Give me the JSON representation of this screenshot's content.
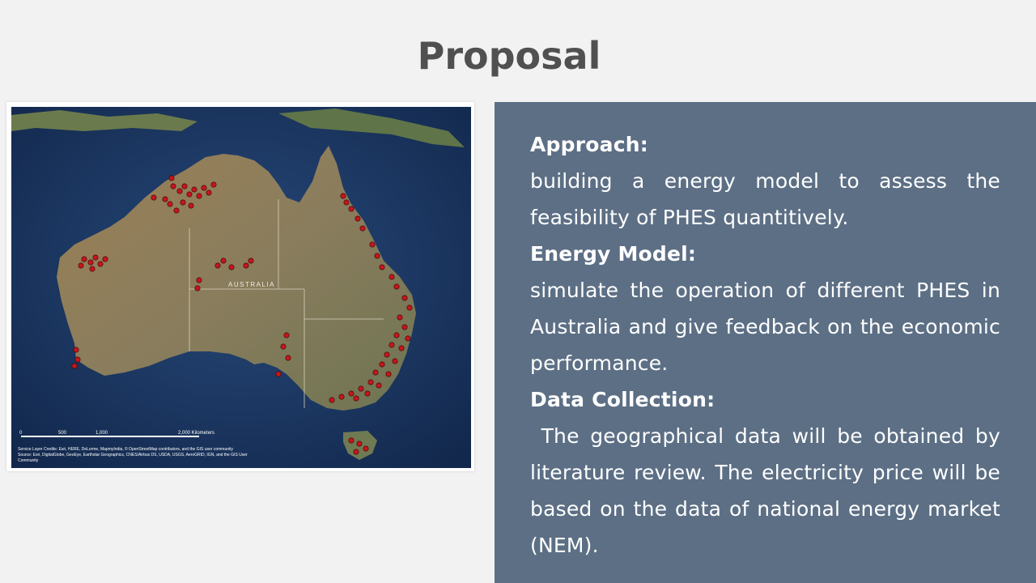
{
  "slide": {
    "title": "Proposal"
  },
  "map": {
    "country_label": "AUSTRALIA",
    "scale_labels": [
      "0",
      "500",
      "1,000",
      "2,000 Kilometers"
    ],
    "credits_line1": "Service Layer Credits: Esri, HERE, DeLorme, MapmyIndia, © OpenStreetMap contributors, and the GIS user community",
    "credits_line2": "Source: Esri, DigitalGlobe, GeoEye, Earthstar Geographics, CNES/Airbus DS, USDA, USGS, AeroGRID, IGN, and the GIS User",
    "credits_line3": "Community",
    "colors": {
      "ocean": "#1c3a6b",
      "land": "#8c7e5e",
      "sites": "#c4161c"
    }
  },
  "panel": {
    "sections": [
      {
        "heading": "Approach:",
        "body": "building a energy model to assess the feasibility of PHES quantitively."
      },
      {
        "heading": "Energy Model:",
        "body": "simulate the operation of different PHES in Australia and give feedback on the economic performance."
      },
      {
        "heading": "Data Collection:",
        "body": " The geographical data will be obtained by literature review. The electricity price will be based on the data of national energy market (NEM)."
      }
    ]
  }
}
